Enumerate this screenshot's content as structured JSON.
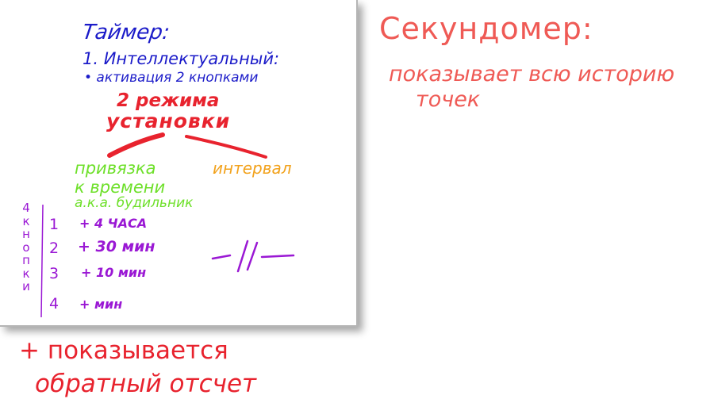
{
  "timer": {
    "title": "Таймер:",
    "item1": "1. Интеллектуальный:",
    "item2": "• активация 2 кнопками",
    "modes_line1": "2 режима",
    "modes_line2": "установки",
    "branch_left": [
      "привязка",
      "к времени",
      "а.к.а. будильник"
    ],
    "branch_right": "интервал",
    "buttons_label": [
      "к",
      "н",
      "о",
      "п",
      "к",
      "и"
    ],
    "buttons_label_prefix": "4",
    "button_numbers": [
      "1",
      "2",
      "3",
      "4"
    ],
    "button_actions": [
      "+ 4 ЧАСА",
      "+ 30 мин",
      "+ 10 мин",
      "+ мин"
    ],
    "countdown_line1": "+ показывается",
    "countdown_line2": "обратный отсчет"
  },
  "stopwatch": {
    "title": "Секундомер:",
    "line1": "показывает всю историю",
    "line2": "точек"
  },
  "colors": {
    "blue": "#1b1bc9",
    "red": "#e8232e",
    "green": "#6ee02a",
    "orange": "#f2a21c",
    "purple": "#9a18d4",
    "salmon": "#ef5a55"
  }
}
